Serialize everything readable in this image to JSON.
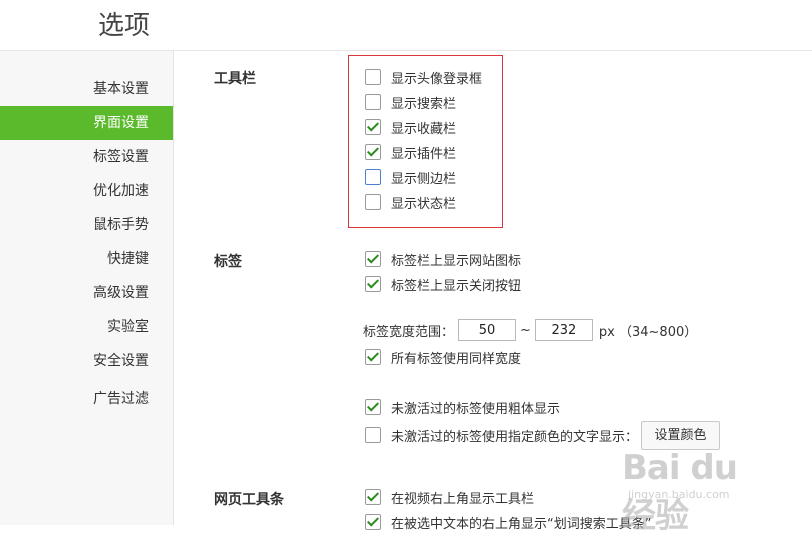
{
  "header": {
    "title": "选项"
  },
  "sidebar": {
    "items": [
      {
        "label": "基本设置",
        "active": false
      },
      {
        "label": "界面设置",
        "active": true
      },
      {
        "label": "标签设置",
        "active": false
      },
      {
        "label": "优化加速",
        "active": false
      },
      {
        "label": "鼠标手势",
        "active": false
      },
      {
        "label": "快捷键",
        "active": false
      },
      {
        "label": "高级设置",
        "active": false
      },
      {
        "label": "实验室",
        "active": false
      },
      {
        "label": "安全设置",
        "active": false
      },
      {
        "label": "广告过滤",
        "active": false
      }
    ]
  },
  "sections": {
    "toolbar": {
      "label": "工具栏",
      "options": [
        {
          "label": "显示头像登录框",
          "checked": false
        },
        {
          "label": "显示搜索栏",
          "checked": false
        },
        {
          "label": "显示收藏栏",
          "checked": true
        },
        {
          "label": "显示插件栏",
          "checked": true
        },
        {
          "label": "显示侧边栏",
          "checked": false
        },
        {
          "label": "显示状态栏",
          "checked": false
        }
      ]
    },
    "tabs": {
      "label": "标签",
      "options": [
        {
          "label": "标签栏上显示网站图标",
          "checked": true
        },
        {
          "label": "标签栏上显示关闭按钮",
          "checked": true
        }
      ],
      "width_range": {
        "label": "标签宽度范围：",
        "min": "50",
        "separator": "~",
        "max": "232",
        "unit": "px （34~800）"
      },
      "same_width": {
        "label": "所有标签使用同样宽度",
        "checked": true
      },
      "bold_inactive": {
        "label": "未激活过的标签使用粗体显示",
        "checked": true
      },
      "color_inactive": {
        "label": "未激活过的标签使用指定颜色的文字显示：",
        "checked": false
      },
      "set_color_button": "设置颜色"
    },
    "webpage_toolbar": {
      "label": "网页工具条",
      "options": [
        {
          "label": "在视频右上角显示工具栏",
          "checked": true
        },
        {
          "label": "在被选中文本的右上角显示“划词搜索工具条”",
          "checked": true
        }
      ]
    }
  },
  "watermark": {
    "main": "Bai du 经验",
    "sub": "jingyan.baidu.com"
  },
  "colors": {
    "accent": "#5aba2b",
    "highlight": "#d9363e",
    "check": "#2a8a1c"
  }
}
